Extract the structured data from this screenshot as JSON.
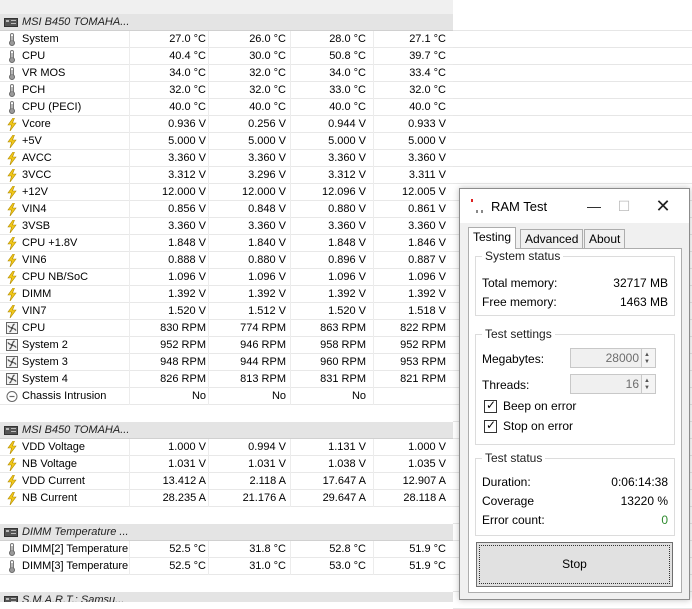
{
  "sensor_sections": [
    {
      "title": "MSI B450 TOMAHA...",
      "rows": [
        {
          "icon": "thermometer-icon",
          "label": "System",
          "values": [
            "27.0 °C",
            "26.0 °C",
            "28.0 °C",
            "27.1 °C"
          ]
        },
        {
          "icon": "thermometer-icon",
          "label": "CPU",
          "values": [
            "40.4 °C",
            "30.0 °C",
            "50.8 °C",
            "39.7 °C"
          ]
        },
        {
          "icon": "thermometer-icon",
          "label": "VR MOS",
          "values": [
            "34.0 °C",
            "32.0 °C",
            "34.0 °C",
            "33.4 °C"
          ]
        },
        {
          "icon": "thermometer-icon",
          "label": "PCH",
          "values": [
            "32.0 °C",
            "32.0 °C",
            "33.0 °C",
            "32.0 °C"
          ]
        },
        {
          "icon": "thermometer-icon",
          "label": "CPU (PECI)",
          "values": [
            "40.0 °C",
            "40.0 °C",
            "40.0 °C",
            "40.0 °C"
          ]
        },
        {
          "icon": "lightning-icon",
          "label": "Vcore",
          "values": [
            "0.936 V",
            "0.256 V",
            "0.944 V",
            "0.933 V"
          ]
        },
        {
          "icon": "lightning-icon",
          "label": "+5V",
          "values": [
            "5.000 V",
            "5.000 V",
            "5.000 V",
            "5.000 V"
          ]
        },
        {
          "icon": "lightning-icon",
          "label": "AVCC",
          "values": [
            "3.360 V",
            "3.360 V",
            "3.360 V",
            "3.360 V"
          ]
        },
        {
          "icon": "lightning-icon",
          "label": "3VCC",
          "values": [
            "3.312 V",
            "3.296 V",
            "3.312 V",
            "3.311 V"
          ]
        },
        {
          "icon": "lightning-icon",
          "label": "+12V",
          "values": [
            "12.000 V",
            "12.000 V",
            "12.096 V",
            "12.005 V"
          ]
        },
        {
          "icon": "lightning-icon",
          "label": "VIN4",
          "values": [
            "0.856 V",
            "0.848 V",
            "0.880 V",
            "0.861 V"
          ]
        },
        {
          "icon": "lightning-icon",
          "label": "3VSB",
          "values": [
            "3.360 V",
            "3.360 V",
            "3.360 V",
            "3.360 V"
          ]
        },
        {
          "icon": "lightning-icon",
          "label": "CPU +1.8V",
          "values": [
            "1.848 V",
            "1.840 V",
            "1.848 V",
            "1.846 V"
          ]
        },
        {
          "icon": "lightning-icon",
          "label": "VIN6",
          "values": [
            "0.888 V",
            "0.880 V",
            "0.896 V",
            "0.887 V"
          ]
        },
        {
          "icon": "lightning-icon",
          "label": "CPU NB/SoC",
          "values": [
            "1.096 V",
            "1.096 V",
            "1.096 V",
            "1.096 V"
          ]
        },
        {
          "icon": "lightning-icon",
          "label": "DIMM",
          "values": [
            "1.392 V",
            "1.392 V",
            "1.392 V",
            "1.392 V"
          ]
        },
        {
          "icon": "lightning-icon",
          "label": "VIN7",
          "values": [
            "1.520 V",
            "1.512 V",
            "1.520 V",
            "1.518 V"
          ]
        },
        {
          "icon": "fan-icon",
          "label": "CPU",
          "values": [
            "830 RPM",
            "774 RPM",
            "863 RPM",
            "822 RPM"
          ]
        },
        {
          "icon": "fan-icon",
          "label": "System 2",
          "values": [
            "952 RPM",
            "946 RPM",
            "958 RPM",
            "952 RPM"
          ]
        },
        {
          "icon": "fan-icon",
          "label": "System 3",
          "values": [
            "948 RPM",
            "944 RPM",
            "960 RPM",
            "953 RPM"
          ]
        },
        {
          "icon": "fan-icon",
          "label": "System 4",
          "values": [
            "826 RPM",
            "813 RPM",
            "831 RPM",
            "821 RPM"
          ]
        },
        {
          "icon": "intrusion-icon",
          "label": "Chassis Intrusion",
          "values": [
            "No",
            "No",
            "No",
            ""
          ]
        }
      ]
    },
    {
      "title": "MSI B450 TOMAHA...",
      "rows": [
        {
          "icon": "lightning-icon",
          "label": "VDD Voltage",
          "values": [
            "1.000 V",
            "0.994 V",
            "1.131 V",
            "1.000 V"
          ]
        },
        {
          "icon": "lightning-icon",
          "label": "NB Voltage",
          "values": [
            "1.031 V",
            "1.031 V",
            "1.038 V",
            "1.035 V"
          ]
        },
        {
          "icon": "lightning-icon",
          "label": "VDD Current",
          "values": [
            "13.412 A",
            "2.118 A",
            "17.647 A",
            "12.907 A"
          ]
        },
        {
          "icon": "lightning-icon",
          "label": "NB Current",
          "values": [
            "28.235 A",
            "21.176 A",
            "29.647 A",
            "28.118 A"
          ]
        }
      ]
    },
    {
      "title": "DIMM Temperature ...",
      "rows": [
        {
          "icon": "thermometer-icon",
          "label": "DIMM[2] Temperature",
          "values": [
            "52.5 °C",
            "31.8 °C",
            "52.8 °C",
            "51.9 °C"
          ]
        },
        {
          "icon": "thermometer-icon",
          "label": "DIMM[3] Temperature",
          "values": [
            "52.5 °C",
            "31.0 °C",
            "53.0 °C",
            "51.9 °C"
          ]
        }
      ]
    },
    {
      "title": "S.M.A.R.T.: Samsu...",
      "rows": []
    }
  ],
  "dialog": {
    "title": "RAM Test",
    "window_buttons": {
      "minimize": "—",
      "maximize": "☐",
      "close": "✕"
    },
    "tabs": [
      "Testing",
      "Advanced",
      "About"
    ],
    "active_tab": "Testing",
    "system_status": {
      "label": "System status",
      "total_memory_label": "Total memory:",
      "total_memory_value": "32717 MB",
      "free_memory_label": "Free memory:",
      "free_memory_value": "1463 MB"
    },
    "test_settings": {
      "label": "Test settings",
      "megabytes_label": "Megabytes:",
      "megabytes_value": "28000",
      "threads_label": "Threads:",
      "threads_value": "16",
      "beep_label": "Beep on error",
      "beep_checked": true,
      "stop_label": "Stop on error",
      "stop_checked": true
    },
    "test_status": {
      "label": "Test status",
      "duration_label": "Duration:",
      "duration_value": "0:06:14:38",
      "coverage_label": "Coverage",
      "coverage_value": "13220 %",
      "error_label": "Error count:",
      "error_value": "0"
    },
    "stop_button": "Stop"
  },
  "colors": {
    "thermometer": "#8a8a8a",
    "lightning": "#e8c21a",
    "error_count": "#2e8b2e",
    "section_header": "#e4e4e4"
  }
}
